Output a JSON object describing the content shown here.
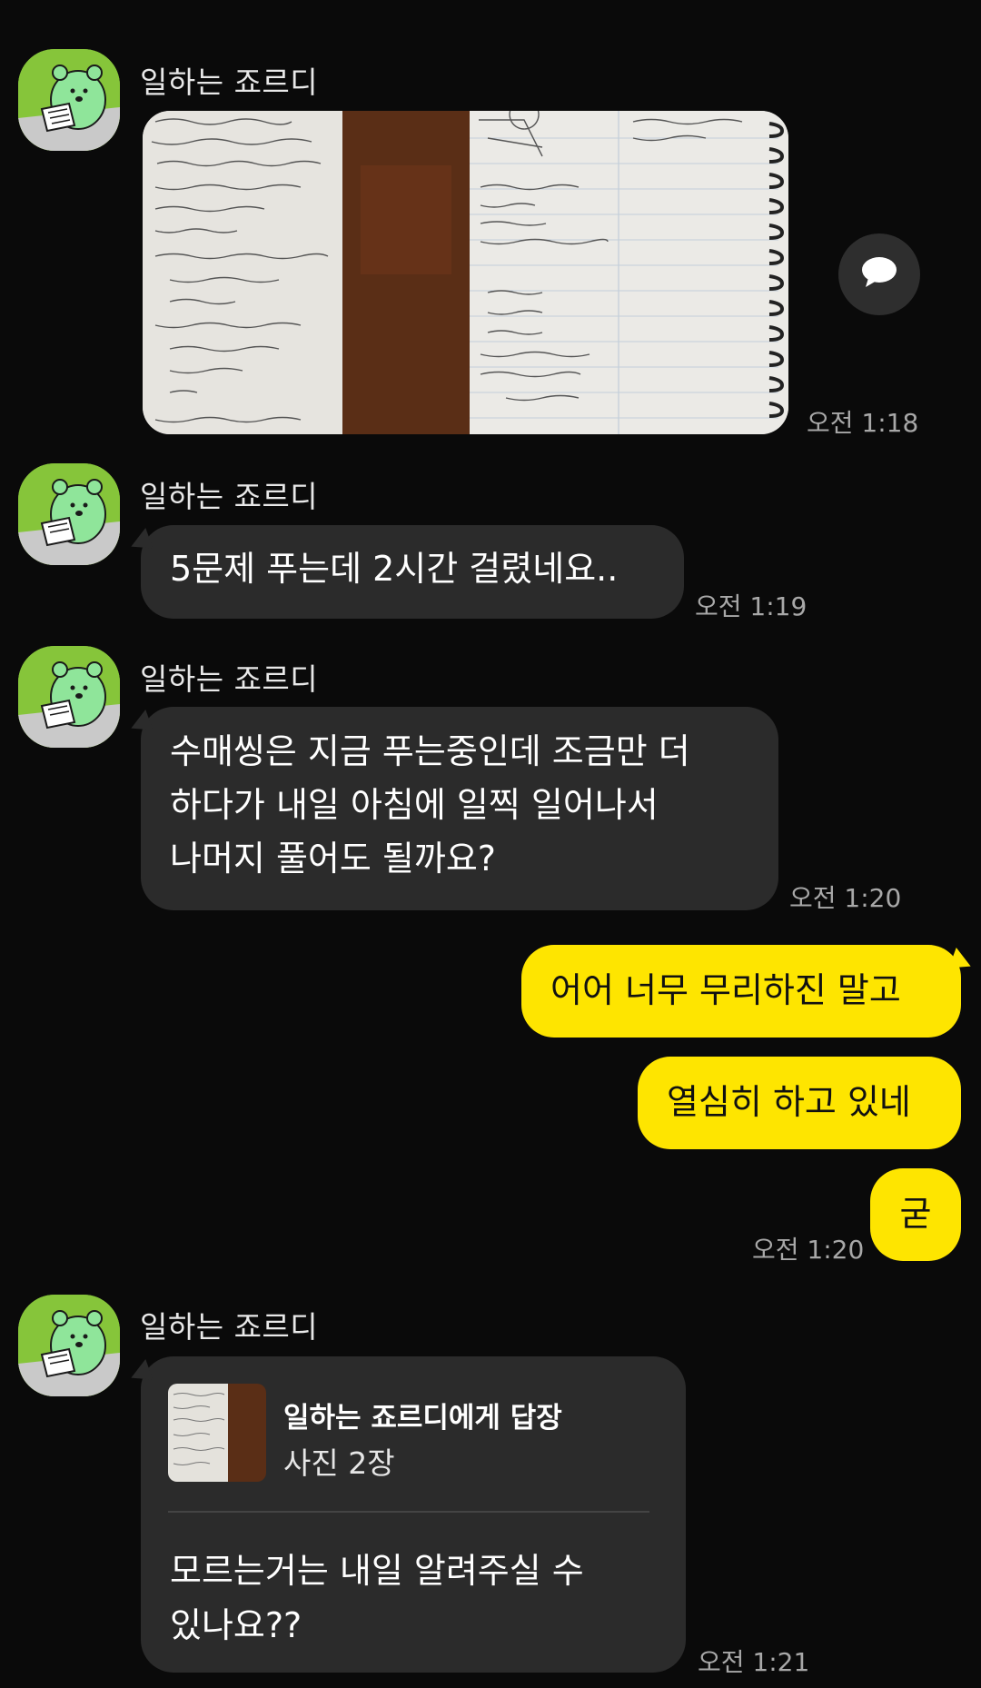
{
  "colors": {
    "background": "#0a0a0a",
    "incoming_bubble": "#2b2b2b",
    "outgoing_bubble": "#fee500",
    "avatar_bg": "#86c53a"
  },
  "messages": [
    {
      "sender": "일하는 죠르디",
      "type": "photo",
      "time": "오전 1:18"
    },
    {
      "sender": "일하는 죠르디",
      "text": "5문제 푸는데 2시간 걸렸네요..",
      "time": "오전 1:19"
    },
    {
      "sender": "일하는 죠르디",
      "lines": [
        "수매씽은 지금 푸는중인데 조금만 더",
        "하다가 내일 아침에 일찍 일어나서",
        "나머지 풀어도 될까요?"
      ],
      "time": "오전 1:20"
    },
    {
      "sender": "me",
      "text": "어어 너무 무리하진 말고"
    },
    {
      "sender": "me",
      "text": "열심히 하고 있네"
    },
    {
      "sender": "me",
      "text": "굳",
      "time": "오전 1:20"
    },
    {
      "sender": "일하는 죠르디",
      "reply": {
        "title": "일하는 죠르디에게 답장",
        "subtitle": "사진 2장"
      },
      "lines": [
        "모르는거는 내일 알려주실 수",
        "있나요??"
      ],
      "time": "오전 1:21"
    }
  ],
  "icons": {
    "share": "speech-bubble-icon",
    "avatar": "jordy-character-avatar"
  }
}
